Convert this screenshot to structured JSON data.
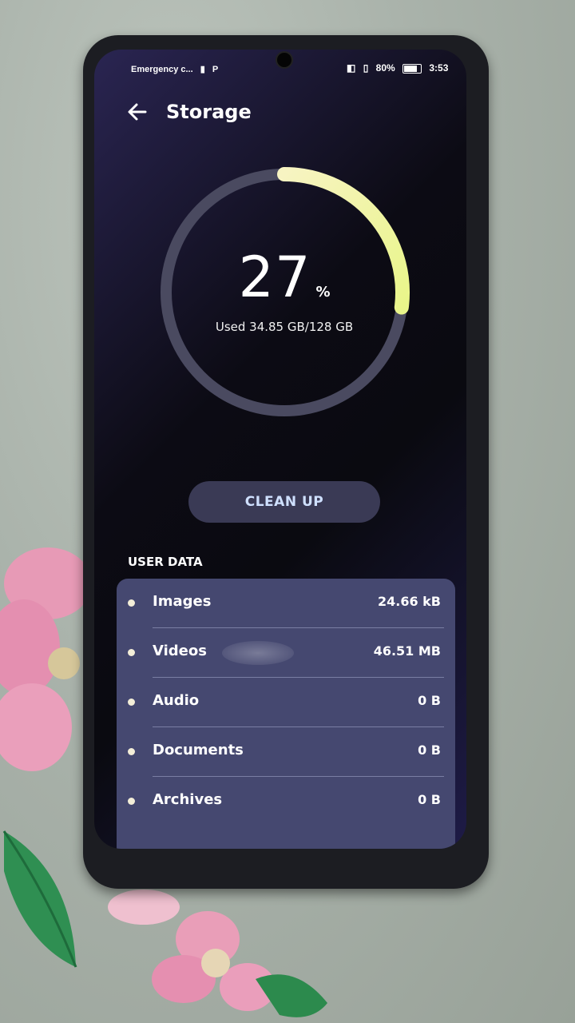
{
  "status_bar": {
    "carrier": "Emergency c...",
    "battery": "80%",
    "time": "3:53"
  },
  "header": {
    "title": "Storage",
    "back_icon": "back-arrow-icon"
  },
  "storage": {
    "percent": "27",
    "percent_sign": "%",
    "used_text": "Used 34.85 GB/128 GB",
    "fraction_used": 0.27
  },
  "clean_button": {
    "label": "CLEAN UP"
  },
  "user_data": {
    "label": "USER DATA",
    "items": [
      {
        "name": "Images",
        "size": "24.66 kB"
      },
      {
        "name": "Videos",
        "size": "46.51 MB"
      },
      {
        "name": "Audio",
        "size": "0 B"
      },
      {
        "name": "Documents",
        "size": "0 B"
      },
      {
        "name": "Archives",
        "size": "0 B"
      }
    ]
  },
  "colors": {
    "gauge_track": "#4a4a60",
    "gauge_fill_start": "#e9f58a",
    "gauge_fill_end": "#f7f4c2",
    "card_bg": "#454870",
    "button_bg": "#3a3a55",
    "button_text": "#cfe0ff"
  }
}
